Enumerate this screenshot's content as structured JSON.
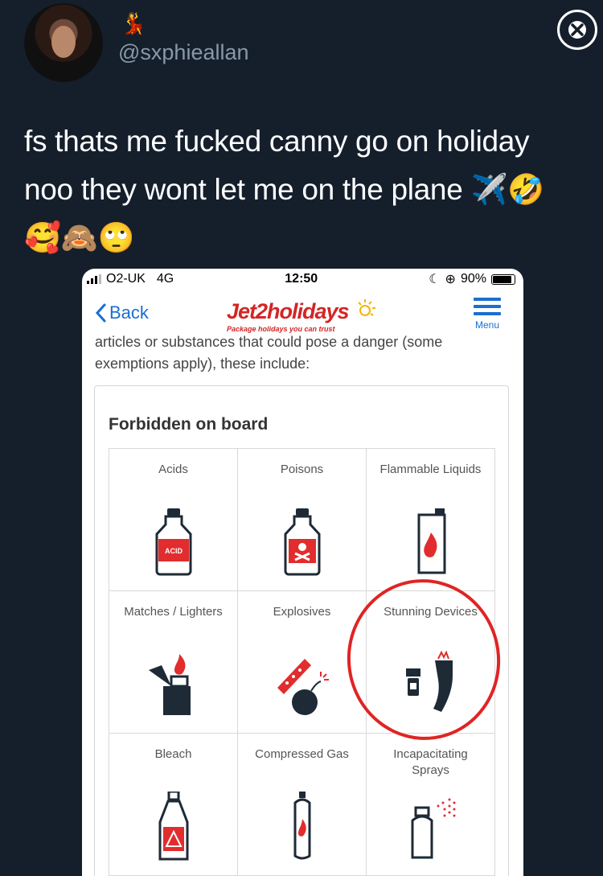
{
  "tweet": {
    "name_emoji": "💃",
    "handle": "@sxphieallan",
    "text_line1": "fs thats me fucked canny go on holiday",
    "text_line2": "noo they wont let me on the plane ✈️🤣",
    "text_line3": "🥰🙈🙄"
  },
  "phone": {
    "status": {
      "carrier": "O2-UK",
      "network": "4G",
      "time": "12:50",
      "battery": "90%"
    },
    "nav": {
      "back_label": "Back",
      "logo": "Jet2holidays",
      "logo_tagline": "Package holidays you can trust",
      "menu_label": "Menu"
    },
    "intro": "articles or substances that could pose a danger (some exemptions apply), these include:",
    "card_title": "Forbidden on board",
    "items": [
      {
        "label": "Acids",
        "icon": "acid-bottle-icon"
      },
      {
        "label": "Poisons",
        "icon": "poison-bottle-icon"
      },
      {
        "label": "Flammable Liquids",
        "icon": "flammable-can-icon"
      },
      {
        "label": "Matches / Lighters",
        "icon": "lighter-icon"
      },
      {
        "label": "Explosives",
        "icon": "explosives-icon"
      },
      {
        "label": "Stunning Devices",
        "icon": "stun-gun-icon"
      },
      {
        "label": "Bleach",
        "icon": "bleach-bottle-icon"
      },
      {
        "label": "Compressed Gas",
        "icon": "gas-cylinder-icon"
      },
      {
        "label": "Incapacitating Sprays",
        "icon": "spray-can-icon"
      }
    ],
    "acid_label": "ACID"
  },
  "colors": {
    "background": "#151f2c",
    "brand_red": "#d42525",
    "link_blue": "#1a6fcf",
    "annotation_red": "#e02424"
  }
}
